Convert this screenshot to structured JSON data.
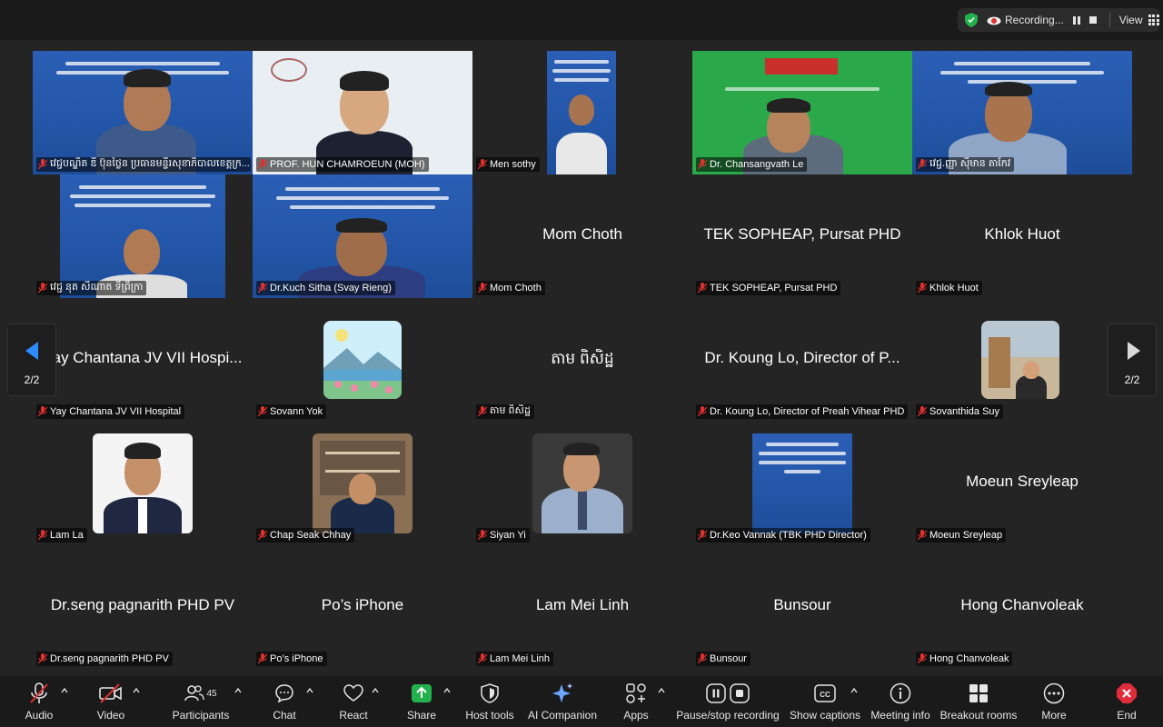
{
  "topbar": {
    "recording_label": "Recording...",
    "view_label": "View"
  },
  "tiles": [
    {
      "name": "វេជ្ជបណ្ឌិត ឌី ប៊ុនថ្លៃន ប្រធានមន្ទីរសុខាភិបាលខេត្តក្រ...",
      "big": "",
      "muted": true
    },
    {
      "name": "PROF. HUN CHAMROEUN (MOH)",
      "big": "",
      "muted": true
    },
    {
      "name": "Men sothy",
      "big": "",
      "muted": true
    },
    {
      "name": "Dr. Chansangvath Le",
      "big": "",
      "muted": true
    },
    {
      "name": "វេជ្ជ.ញ្ញា ស៊ឹមាន តាកែវ",
      "big": "",
      "muted": true
    },
    {
      "name": "វេជ្ជ នុត សីណាត ទីព្រីក្រា",
      "big": "",
      "muted": true
    },
    {
      "name": "Dr.Kuch Sitha (Svay Rieng)",
      "big": "",
      "muted": true
    },
    {
      "name": "Mom Choth",
      "big": "Mom Choth",
      "muted": true
    },
    {
      "name": "TEK SOPHEAP, Pursat PHD",
      "big": "TEK SOPHEAP, Pursat PHD",
      "muted": true
    },
    {
      "name": "Khlok Huot",
      "big": "Khlok Huot",
      "muted": true
    },
    {
      "name": "Yay Chantana JV VII Hospital",
      "big": "Yay Chantana JV VII Hospi...",
      "muted": true
    },
    {
      "name": "Sovann Yok",
      "big": "",
      "muted": true
    },
    {
      "name": "តាម ពិសិដ្ឋ",
      "big": "តាម ពិសិដ្ឋ",
      "muted": true
    },
    {
      "name": "Dr. Koung Lo, Director of Preah Vihear PHD",
      "big": "Dr. Koung Lo, Director of P...",
      "muted": true
    },
    {
      "name": "Sovanthida Suy",
      "big": "",
      "muted": true
    },
    {
      "name": "Lam La",
      "big": "",
      "muted": true
    },
    {
      "name": "Chap Seak Chhay",
      "big": "",
      "muted": true
    },
    {
      "name": "Siyan Yi",
      "big": "",
      "muted": true
    },
    {
      "name": "Dr.Keo Vannak (TBK PHD Director)",
      "big": "",
      "muted": true
    },
    {
      "name": "Moeun Sreyleap",
      "big": "Moeun Sreyleap",
      "muted": true
    },
    {
      "name": "Dr.seng pagnarith PHD PV",
      "big": "Dr.seng pagnarith PHD PV",
      "muted": true
    },
    {
      "name": "Po’s iPhone",
      "big": "Po’s iPhone",
      "muted": true
    },
    {
      "name": "Lam Mei Linh",
      "big": "Lam Mei Linh",
      "muted": true
    },
    {
      "name": "Bunsour",
      "big": "Bunsour",
      "muted": true
    },
    {
      "name": "Hong Chanvoleak",
      "big": "Hong Chanvoleak",
      "muted": true
    }
  ],
  "pagination": {
    "left": "2/2",
    "right": "2/2"
  },
  "toolbar": {
    "audio": "Audio",
    "video": "Video",
    "participants": "Participants",
    "participants_count": "45",
    "chat": "Chat",
    "react": "React",
    "share": "Share",
    "host_tools": "Host tools",
    "ai_companion": "AI Companion",
    "apps": "Apps",
    "pause_stop": "Pause/stop recording",
    "captions": "Show captions",
    "meeting_info": "Meeting info",
    "breakout": "Breakout rooms",
    "more": "More",
    "end": "End"
  },
  "colors": {
    "accent_green": "#22b14c",
    "end_red": "#e02d3c",
    "muted_red": "#e0312f"
  }
}
